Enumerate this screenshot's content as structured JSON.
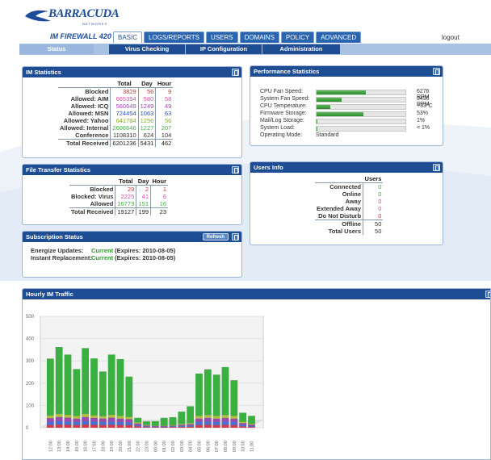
{
  "header": {
    "logo_text": "BARRACUDA",
    "logo_sub": "NETWORKS",
    "product": "IM FIREWALL 420",
    "logout": "logout"
  },
  "main_tabs": [
    "BASIC",
    "LOGS/REPORTS",
    "USERS",
    "DOMAINS",
    "POLICY",
    "ADVANCED"
  ],
  "sub_tabs": [
    "Status",
    "Virus Checking",
    "IP Configuration",
    "Administration"
  ],
  "im_stats": {
    "title": "IM Statistics",
    "headers": [
      "Total",
      "Day",
      "Hour"
    ],
    "rows": [
      {
        "label": "Blocked",
        "total": "3829",
        "day": "56",
        "hour": "9",
        "color": "#d03030"
      },
      {
        "label": "Allowed: AIM",
        "total": "665354",
        "day": "580",
        "hour": "58",
        "color": "#d050a0"
      },
      {
        "label": "Allowed: ICQ",
        "total": "560649",
        "day": "1249",
        "hour": "49",
        "color": "#a040c0"
      },
      {
        "label": "Allowed: MSN",
        "total": "724454",
        "day": "1063",
        "hour": "63",
        "color": "#2050c0"
      },
      {
        "label": "Allowed: Yahoo",
        "total": "641784",
        "day": "1256",
        "hour": "56",
        "color": "#80b020"
      },
      {
        "label": "Allowed: Internal",
        "total": "2606646",
        "day": "1227",
        "hour": "207",
        "color": "#40b040"
      },
      {
        "label": "Conference",
        "total": "1108310",
        "day": "624",
        "hour": "104",
        "color": "#333333"
      }
    ],
    "total": {
      "label": "Total Received",
      "total": "6201236",
      "day": "5431",
      "hour": "462"
    }
  },
  "file_stats": {
    "title": "File Transfer Statistics",
    "headers": [
      "Total",
      "Day",
      "Hour"
    ],
    "rows": [
      {
        "label": "Blocked",
        "total": "29",
        "day": "2",
        "hour": "1",
        "color": "#d03030"
      },
      {
        "label": "Blocked: Virus",
        "total": "2225",
        "day": "41",
        "hour": "6",
        "color": "#d050a0"
      },
      {
        "label": "Allowed",
        "total": "16773",
        "day": "151",
        "hour": "16",
        "color": "#40b040"
      }
    ],
    "total": {
      "label": "Total Received",
      "total": "19127",
      "day": "199",
      "hour": "23"
    }
  },
  "subscription": {
    "title": "Subscription Status",
    "refresh": "Refresh",
    "rows": [
      {
        "label": "Energize Updates:",
        "status": "Current",
        "expires": "(Expires: 2010-08-05)"
      },
      {
        "label": "Instant Replacement:",
        "status": "Current",
        "expires": "(Expires: 2010-08-05)"
      }
    ]
  },
  "performance": {
    "title": "Performance Statistics",
    "rows": [
      {
        "label": "CPU Fan Speed:",
        "fill": 0.55,
        "value": "6276 RPM"
      },
      {
        "label": "System Fan Speed:",
        "fill": 0.28,
        "value": "3496 RPM"
      },
      {
        "label": "CPU Temperature:",
        "fill": 0.15,
        "value": "+33°C"
      },
      {
        "label": "Firmware Storage:",
        "fill": 0.53,
        "value": "53%"
      },
      {
        "label": "Mail/Log Storage:",
        "fill": 0.01,
        "value": "1%"
      },
      {
        "label": "System Load:",
        "fill": 0.005,
        "value": "< 1%"
      },
      {
        "label": "Operating Mode:",
        "fill": null,
        "value": "Standard"
      }
    ]
  },
  "users_info": {
    "title": "Users Info",
    "header": "Users",
    "rows": [
      {
        "label": "Connected",
        "value": "0",
        "color": "#40b040"
      },
      {
        "label": "Online",
        "value": "0",
        "color": "#40b040"
      },
      {
        "label": "Away",
        "value": "0",
        "color": "#d050a0"
      },
      {
        "label": "Extended Away",
        "value": "0",
        "color": "#d050a0"
      },
      {
        "label": "Do Not Disturb",
        "value": "0",
        "color": "#d03030"
      },
      {
        "label": "Offline",
        "value": "50",
        "color": "#333333"
      },
      {
        "label": "Total Users",
        "value": "50",
        "color": "#333333"
      }
    ]
  },
  "traffic": {
    "title": "Hourly IM Traffic"
  },
  "chart_data": {
    "type": "bar",
    "stacked": true,
    "ylim": [
      0,
      500
    ],
    "yticks": [
      0,
      100,
      200,
      300,
      400,
      500
    ],
    "categories": [
      "12:00",
      "13:00",
      "14:00",
      "15:00",
      "16:00",
      "17:00",
      "18:00",
      "19:00",
      "20:00",
      "21:00",
      "22:00",
      "23:00",
      "00:00",
      "01:00",
      "02:00",
      "03:00",
      "04:00",
      "05:00",
      "06:00",
      "07:00",
      "08:00",
      "09:00",
      "10:00",
      "11:00"
    ],
    "series": [
      {
        "color": "#d63a4a",
        "values": [
          12,
          14,
          13,
          12,
          14,
          13,
          12,
          13,
          12,
          11,
          6,
          3,
          2,
          2,
          3,
          4,
          5,
          12,
          13,
          12,
          13,
          12,
          6,
          4
        ]
      },
      {
        "color": "#4a6fd0",
        "values": [
          15,
          16,
          15,
          14,
          16,
          15,
          14,
          15,
          14,
          13,
          6,
          3,
          2,
          2,
          3,
          4,
          5,
          14,
          15,
          14,
          15,
          14,
          7,
          5
        ]
      },
      {
        "color": "#9a4ab0",
        "values": [
          16,
          18,
          17,
          15,
          18,
          16,
          15,
          17,
          15,
          14,
          7,
          4,
          3,
          3,
          3,
          5,
          6,
          15,
          16,
          15,
          16,
          15,
          8,
          5
        ]
      },
      {
        "color": "#b0c040",
        "values": [
          12,
          14,
          13,
          12,
          14,
          12,
          11,
          13,
          12,
          11,
          5,
          3,
          2,
          2,
          3,
          4,
          5,
          12,
          13,
          12,
          13,
          12,
          6,
          4
        ]
      },
      {
        "color": "#3ab040",
        "values": [
          255,
          300,
          270,
          210,
          295,
          255,
          200,
          270,
          255,
          180,
          20,
          15,
          20,
          35,
          35,
          55,
          75,
          190,
          205,
          185,
          215,
          160,
          40,
          35
        ]
      }
    ]
  }
}
